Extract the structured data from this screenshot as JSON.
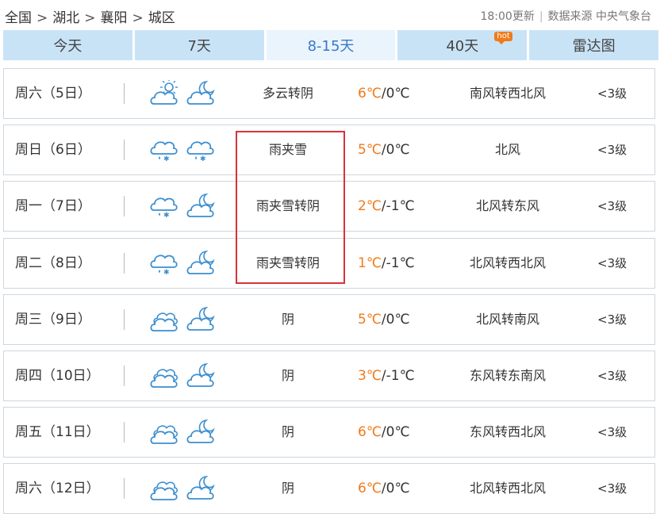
{
  "breadcrumb": {
    "items": [
      "全国",
      "湖北",
      "襄阳",
      "城区"
    ],
    "separator": ">"
  },
  "meta": {
    "updated": "18:00更新",
    "source": "数据来源 中央气象台"
  },
  "tabs": [
    {
      "label": "今天",
      "active": false
    },
    {
      "label": "7天",
      "active": false
    },
    {
      "label": "8-15天",
      "active": true
    },
    {
      "label": "40天",
      "active": false,
      "badge": "hot"
    },
    {
      "label": "雷达图",
      "active": false
    }
  ],
  "forecast": [
    {
      "day": "周六（5日）",
      "icons": [
        "partly-cloudy-day-icon",
        "partly-cloudy-night-icon"
      ],
      "condition": "多云转阴",
      "high": "6℃",
      "low": "/0℃",
      "wind": "南风转西北风",
      "level": "<3级"
    },
    {
      "day": "周日（6日）",
      "icons": [
        "sleet-icon",
        "sleet-icon"
      ],
      "condition": "雨夹雪",
      "high": "5℃",
      "low": "/0℃",
      "wind": "北风",
      "level": "<3级"
    },
    {
      "day": "周一（7日）",
      "icons": [
        "sleet-icon",
        "cloudy-night-icon"
      ],
      "condition": "雨夹雪转阴",
      "high": "2℃",
      "low": "/-1℃",
      "wind": "北风转东风",
      "level": "<3级"
    },
    {
      "day": "周二（8日）",
      "icons": [
        "sleet-icon",
        "cloudy-night-icon"
      ],
      "condition": "雨夹雪转阴",
      "high": "1℃",
      "low": "/-1℃",
      "wind": "北风转西北风",
      "level": "<3级"
    },
    {
      "day": "周三（9日）",
      "icons": [
        "overcast-icon",
        "cloudy-night-icon"
      ],
      "condition": "阴",
      "high": "5℃",
      "low": "/0℃",
      "wind": "北风转南风",
      "level": "<3级"
    },
    {
      "day": "周四（10日）",
      "icons": [
        "overcast-icon",
        "cloudy-night-icon"
      ],
      "condition": "阴",
      "high": "3℃",
      "low": "/-1℃",
      "wind": "东风转东南风",
      "level": "<3级"
    },
    {
      "day": "周五（11日）",
      "icons": [
        "overcast-icon",
        "cloudy-night-icon"
      ],
      "condition": "阴",
      "high": "6℃",
      "low": "/0℃",
      "wind": "东风转西北风",
      "level": "<3级"
    },
    {
      "day": "周六（12日）",
      "icons": [
        "overcast-icon",
        "cloudy-night-icon"
      ],
      "condition": "阴",
      "high": "6℃",
      "low": "/0℃",
      "wind": "北风转西北风",
      "level": "<3级"
    }
  ],
  "colors": {
    "accent": "#3a78c8",
    "tab_bg": "#c9e3f6",
    "tab_active_bg": "#eaf4fc",
    "high_temp": "#f07a1a",
    "highlight_box": "#d9323a",
    "icon_stroke": "#3b8fd0"
  }
}
